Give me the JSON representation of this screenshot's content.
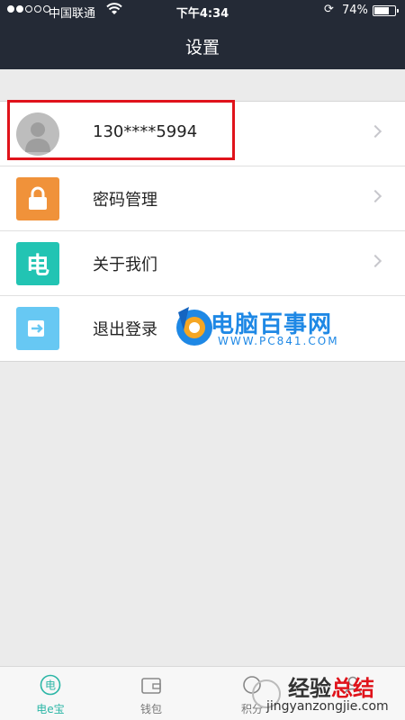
{
  "status_bar": {
    "carrier": "中国联通",
    "time": "下午4:34",
    "battery_percent": "74%",
    "battery_level": 0.74,
    "signal_bars_filled": 2,
    "signal_bars_total": 5
  },
  "nav": {
    "title": "设置"
  },
  "settings": {
    "items": [
      {
        "label": "130****5994",
        "icon": "avatar-icon"
      },
      {
        "label": "密码管理",
        "icon": "lock-icon",
        "color": "#f0923a"
      },
      {
        "label": "关于我们",
        "icon": "dian-icon",
        "glyph": "电",
        "color": "#22c4b3"
      },
      {
        "label": "退出登录",
        "icon": "exit-icon",
        "color": "#67c8f3"
      }
    ]
  },
  "watermark_top": {
    "title": "电脑百事网",
    "url": "WWW.PC841.COM"
  },
  "tabbar": {
    "tabs": [
      {
        "label": "电e宝",
        "icon": "dian-e-bao-icon",
        "glyph": "电"
      },
      {
        "label": "钱包",
        "icon": "wallet-icon"
      },
      {
        "label": "积分",
        "icon": "points-icon"
      },
      {
        "label": "",
        "icon": "me-icon"
      }
    ]
  },
  "watermark_bottom": {
    "line1_black": "经验",
    "line1_red": "总结",
    "url": "jingyanzongjie.com"
  },
  "colors": {
    "header_bg": "#242a36",
    "highlight_border": "#e0131b",
    "accent": "#2bb6a6"
  }
}
